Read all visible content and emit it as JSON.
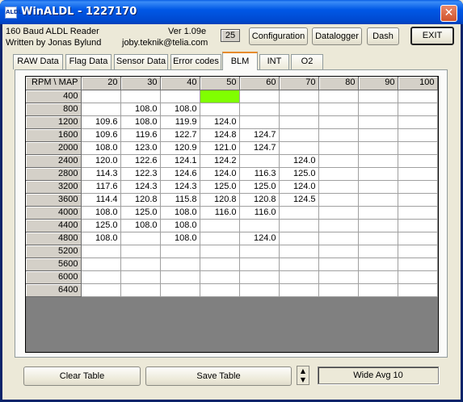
{
  "window": {
    "title": "WinALDL - 1227170",
    "icon_text": "ALDL",
    "close_symbol": "✕"
  },
  "info": {
    "line1": "160 Baud ALDL Reader",
    "line2": "Written by Jonas Bylund",
    "version": "Ver 1.09e",
    "email": "joby.teknik@telia.com",
    "counter": "25"
  },
  "toolbar": {
    "configuration": "Configuration",
    "datalogger": "Datalogger",
    "dash": "Dash",
    "exit": "EXIT"
  },
  "tabs": [
    "RAW Data",
    "Flag Data",
    "Sensor Data",
    "Error codes",
    "BLM",
    "INT",
    "O2"
  ],
  "active_tab": "BLM",
  "table": {
    "corner": "RPM \\ MAP",
    "columns": [
      "20",
      "30",
      "40",
      "50",
      "60",
      "70",
      "80",
      "90",
      "100"
    ],
    "rows": [
      {
        "rpm": "400",
        "cells": [
          "",
          "",
          "",
          "",
          "",
          "",
          "",
          "",
          ""
        ]
      },
      {
        "rpm": "800",
        "cells": [
          "",
          "108.0",
          "108.0",
          "",
          "",
          "",
          "",
          "",
          ""
        ]
      },
      {
        "rpm": "1200",
        "cells": [
          "109.6",
          "108.0",
          "119.9",
          "124.0",
          "",
          "",
          "",
          "",
          ""
        ]
      },
      {
        "rpm": "1600",
        "cells": [
          "109.6",
          "119.6",
          "122.7",
          "124.8",
          "124.7",
          "",
          "",
          "",
          ""
        ]
      },
      {
        "rpm": "2000",
        "cells": [
          "108.0",
          "123.0",
          "120.9",
          "121.0",
          "124.7",
          "",
          "",
          "",
          ""
        ]
      },
      {
        "rpm": "2400",
        "cells": [
          "120.0",
          "122.6",
          "124.1",
          "124.2",
          "",
          "124.0",
          "",
          "",
          ""
        ]
      },
      {
        "rpm": "2800",
        "cells": [
          "114.3",
          "122.3",
          "124.6",
          "124.0",
          "116.3",
          "125.0",
          "",
          "",
          ""
        ]
      },
      {
        "rpm": "3200",
        "cells": [
          "117.6",
          "124.3",
          "124.3",
          "125.0",
          "125.0",
          "124.0",
          "",
          "",
          ""
        ]
      },
      {
        "rpm": "3600",
        "cells": [
          "114.4",
          "120.8",
          "115.8",
          "120.8",
          "120.8",
          "124.5",
          "",
          "",
          ""
        ]
      },
      {
        "rpm": "4000",
        "cells": [
          "108.0",
          "125.0",
          "108.0",
          "116.0",
          "116.0",
          "",
          "",
          "",
          ""
        ]
      },
      {
        "rpm": "4400",
        "cells": [
          "125.0",
          "108.0",
          "108.0",
          "",
          "",
          "",
          "",
          "",
          ""
        ]
      },
      {
        "rpm": "4800",
        "cells": [
          "108.0",
          "",
          "108.0",
          "",
          "124.0",
          "",
          "",
          "",
          ""
        ]
      },
      {
        "rpm": "5200",
        "cells": [
          "",
          "",
          "",
          "",
          "",
          "",
          "",
          "",
          ""
        ]
      },
      {
        "rpm": "5600",
        "cells": [
          "",
          "",
          "",
          "",
          "",
          "",
          "",
          "",
          ""
        ]
      },
      {
        "rpm": "6000",
        "cells": [
          "",
          "",
          "",
          "",
          "",
          "",
          "",
          "",
          ""
        ]
      },
      {
        "rpm": "6400",
        "cells": [
          "",
          "",
          "",
          "",
          "",
          "",
          "",
          "",
          ""
        ]
      }
    ],
    "highlight_cell": {
      "rpm": "400",
      "map": "50"
    },
    "highlight_color": "#80ff00"
  },
  "bottom": {
    "clear_table": "Clear Table",
    "save_table": "Save Table",
    "spin_up": "▲",
    "spin_down": "▼",
    "status": "Wide Avg 10"
  }
}
